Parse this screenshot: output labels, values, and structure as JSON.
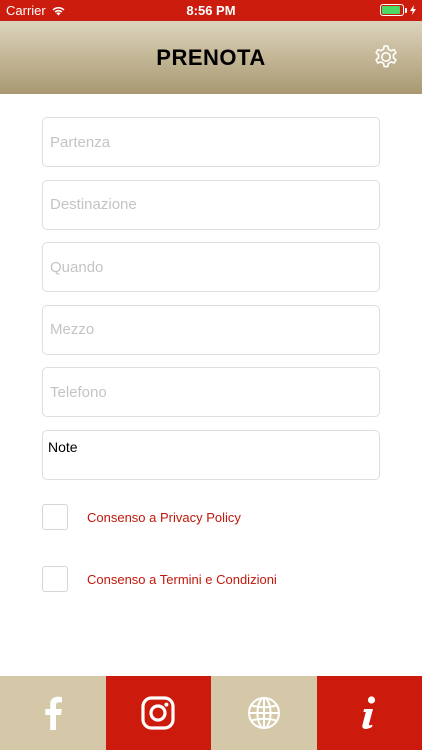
{
  "status_bar": {
    "carrier": "Carrier",
    "time": "8:56 PM",
    "battery_level": 0.9
  },
  "header": {
    "title": "PRENOTA",
    "settings_icon": "gear-icon"
  },
  "form": {
    "fields": [
      {
        "placeholder": "Partenza",
        "value": ""
      },
      {
        "placeholder": "Destinazione",
        "value": ""
      },
      {
        "placeholder": "Quando",
        "value": ""
      },
      {
        "placeholder": "Mezzo",
        "value": ""
      },
      {
        "placeholder": "Telefono",
        "value": ""
      }
    ],
    "note_label": "Note"
  },
  "consents": [
    {
      "label": "Consenso a Privacy Policy",
      "checked": false
    },
    {
      "label": "Consenso a Termini e Condizioni",
      "checked": false
    }
  ],
  "bottom_bar": {
    "buttons": [
      {
        "icon": "facebook-icon"
      },
      {
        "icon": "instagram-icon"
      },
      {
        "icon": "globe-icon"
      },
      {
        "icon": "info-icon"
      }
    ]
  },
  "colors": {
    "status_bar": "#cc1c0e",
    "accent_red": "#cc1a0c",
    "beige": "#d5c8a8",
    "consent_text": "#c0180b"
  }
}
